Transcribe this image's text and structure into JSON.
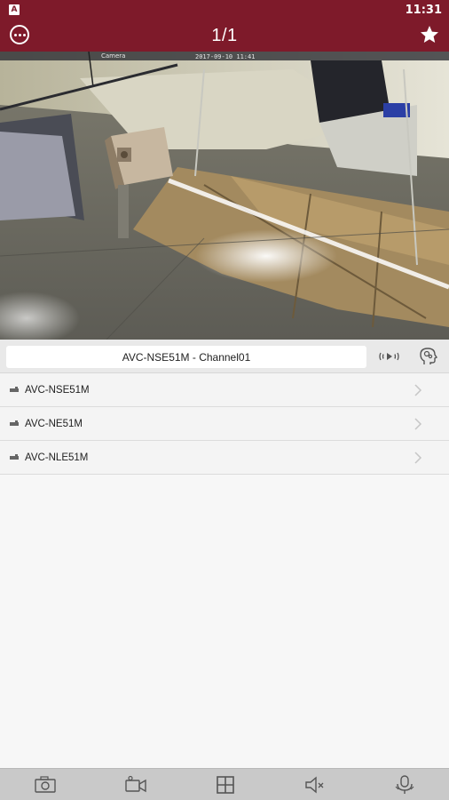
{
  "status_bar": {
    "indicator": "A",
    "time": "11:31"
  },
  "header": {
    "title": "1/1",
    "more_icon": "more-horizontal-icon",
    "favorite_icon": "star-icon"
  },
  "video": {
    "camera_name": "Camera",
    "timestamp": "2017-09-10 11:41"
  },
  "channel": {
    "name": "AVC-NSE51M - Channel01",
    "audio_icon": "audio-wave-icon",
    "talk_icon": "head-talk-icon"
  },
  "devices": [
    {
      "label": "AVC-NSE51M"
    },
    {
      "label": "AVC-NE51M"
    },
    {
      "label": "AVC-NLE51M"
    }
  ],
  "toolbar": {
    "items": [
      "snapshot-icon",
      "record-icon",
      "layout-grid-icon",
      "mute-icon",
      "ptz-icon"
    ]
  },
  "colors": {
    "brand": "#7e1a2a",
    "toolbar": "#c9c9c9",
    "list_bg": "#f4f4f4"
  }
}
